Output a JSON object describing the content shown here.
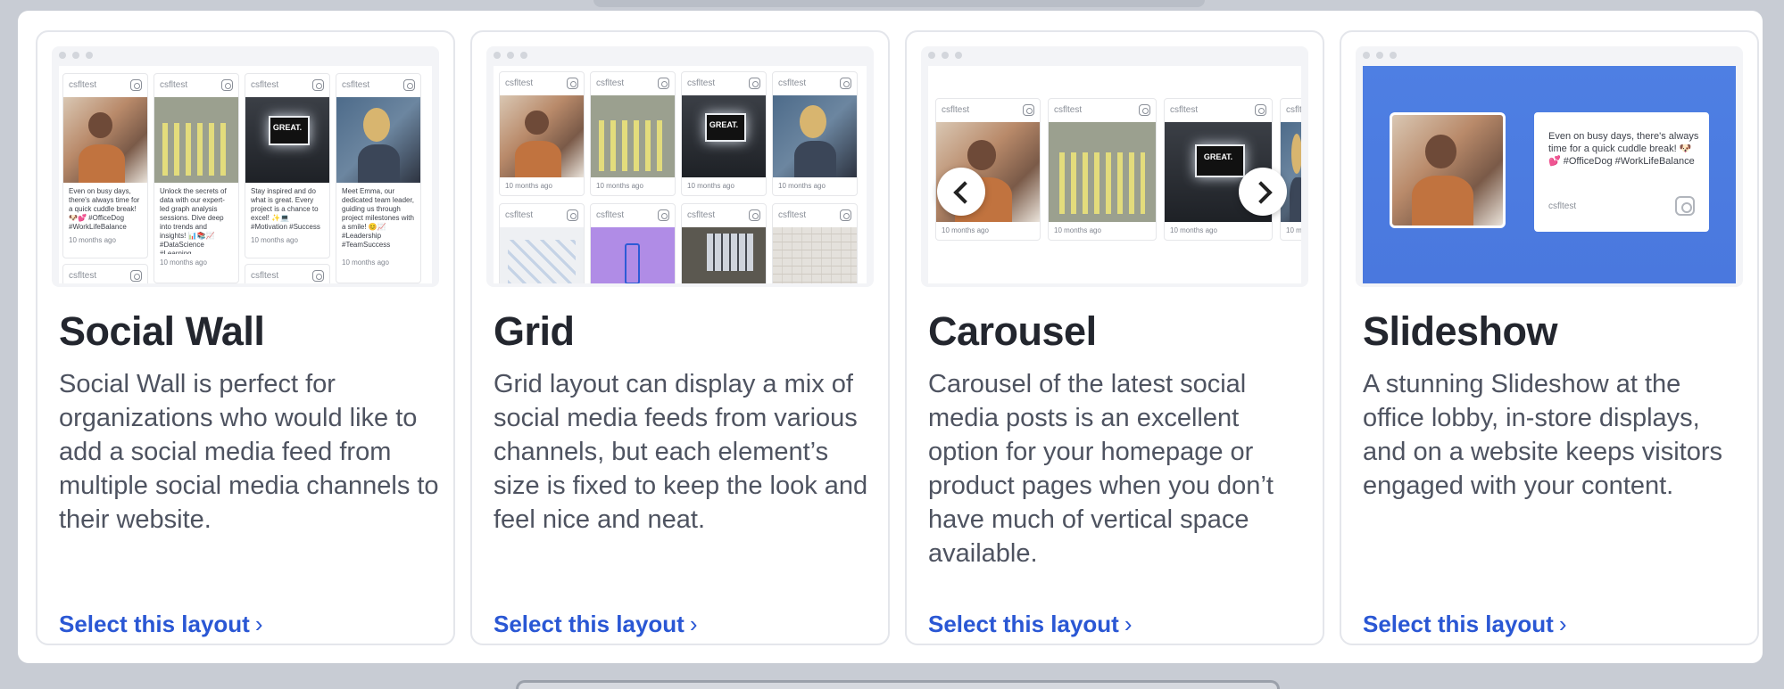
{
  "cards": [
    {
      "title": "Social Wall",
      "description": "Social Wall is perfect for organizations who would like to add a social media feed from multiple social media channels to their website.",
      "link": "Select this layout"
    },
    {
      "title": "Grid",
      "description": "Grid layout can display a mix of social media feeds from various channels, but each element’s size is fixed to keep the look and feel nice and neat.",
      "link": "Select this layout"
    },
    {
      "title": "Carousel",
      "description": "Carousel of the latest social media posts is an excellent option for your homepage or product pages when you don’t have much of vertical space available.",
      "link": "Select this layout"
    },
    {
      "title": "Slideshow",
      "description": "A stunning Slideshow at the office lobby, in-store displays, and on a website keeps visitors engaged with your content.",
      "link": "Select this layout"
    }
  ],
  "preview": {
    "username": "csfltest",
    "time": "10 months ago",
    "time_cut": "10 mo",
    "posts": [
      "Even on busy days, there's always time for a quick cuddle break! 🐶💕 #OfficeDog #WorkLifeBalance",
      "Unlock the secrets of data with our expert-led graph analysis sessions. Dive deep into trends and insights! 📊📚📈 #DataScience #Learning",
      "Stay inspired and do what is great. Every project is a chance to excel! ✨💻 #Motivation #Success",
      "Meet Emma, our dedicated team leader, guiding us through project milestones with a smile! 😊📈 #Leadership #TeamSuccess"
    ],
    "slideshow_text": "Even on busy days, there's always time for a quick cuddle break! 🐶💕 #OfficeDog #WorkLifeBalance"
  },
  "colors": {
    "link": "#2a57d4",
    "slide_bg": "#4e7fe3"
  }
}
